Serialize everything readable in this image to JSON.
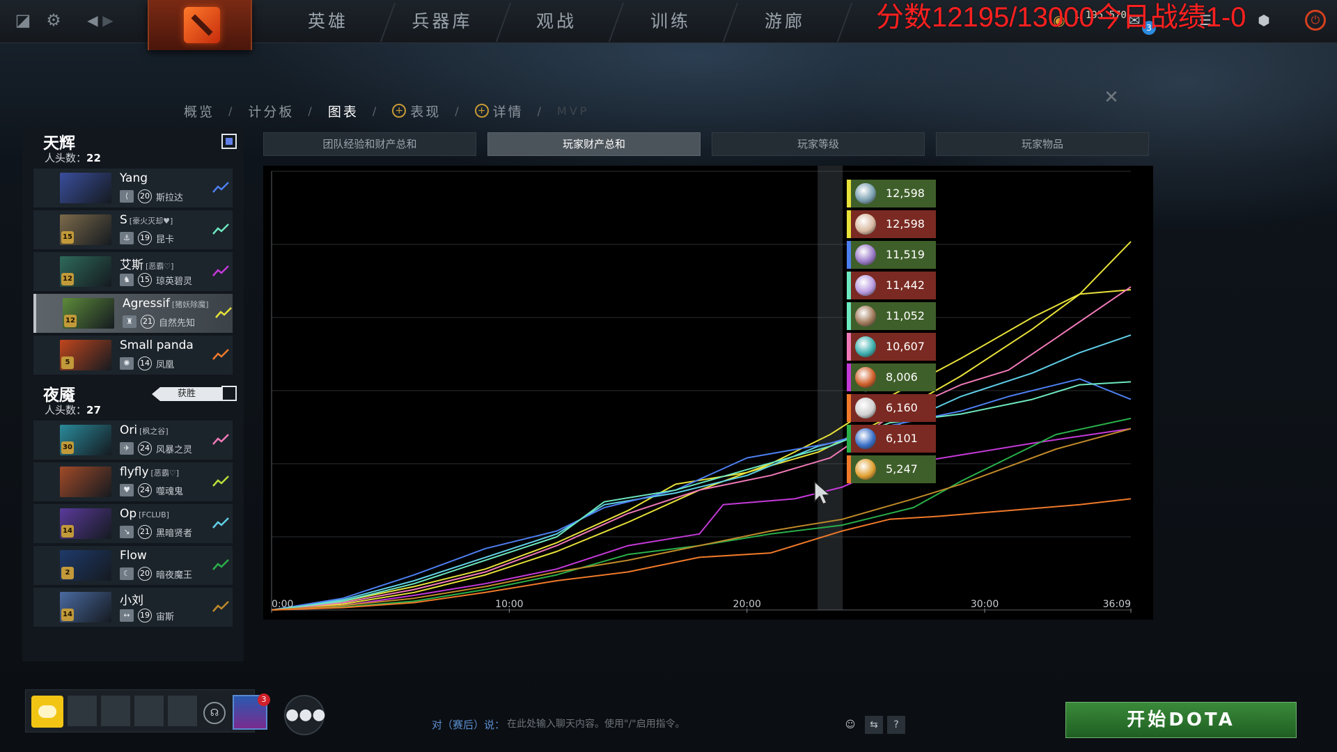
{
  "topbar": {
    "nav": [
      "英雄",
      "兵器库",
      "观战",
      "训练",
      "游廊"
    ],
    "overlay": "分数12195/13000今日战绩1-0",
    "gold": "1 195 570",
    "notifications": "3"
  },
  "breadcrumb": {
    "overview": "概览",
    "scoreboard": "计分板",
    "graphs": "图表",
    "performance": "表现",
    "details": "详情",
    "mvp": "MVP",
    "sep": "/"
  },
  "radiant": {
    "name": "天辉",
    "kills_label": "人头数：",
    "kills": "22",
    "players": [
      {
        "name": "Yang",
        "tag": "",
        "rank": "20",
        "hero": "斯拉达",
        "color": "#4d7ff0",
        "portrait": "#3a4e9c",
        "level": "",
        "role_icon": "⟨"
      },
      {
        "name": "S",
        "tag": "[豪火灭却♥]",
        "rank": "19",
        "hero": "昆卡",
        "color": "#6ee8c0",
        "portrait": "#7c6a4a",
        "level": "15",
        "role_icon": "⚓"
      },
      {
        "name": "艾斯",
        "tag": "[恶霸♡]",
        "rank": "15",
        "hero": "琼英碧灵",
        "color": "#c43ad8",
        "portrait": "#2e6a5a",
        "level": "12",
        "role_icon": "♞"
      },
      {
        "name": "Agressif",
        "tag": "[猪妖除魔]",
        "rank": "21",
        "hero": "自然先知",
        "color": "#e8e23a",
        "portrait": "#5d8a3a",
        "level": "12",
        "role_icon": "♜"
      },
      {
        "name": "Small panda",
        "tag": "",
        "rank": "14",
        "hero": "凤凰",
        "color": "#f07a2a",
        "portrait": "#c0461e",
        "level": "5",
        "role_icon": "✺"
      }
    ]
  },
  "dire": {
    "name": "夜魇",
    "kills_label": "人头数：",
    "kills": "27",
    "win_badge": "获胜",
    "players": [
      {
        "name": "Ori",
        "tag": "[枫之谷]",
        "rank": "24",
        "hero": "风暴之灵",
        "color": "#f07ab8",
        "portrait": "#2a8a9a",
        "level": "30",
        "role_icon": "✈"
      },
      {
        "name": "flyfly",
        "tag": "[恶霸♡]",
        "rank": "24",
        "hero": "噬魂鬼",
        "color": "#b8e23a",
        "portrait": "#a04a28",
        "level": "",
        "role_icon": "♥"
      },
      {
        "name": "Op",
        "tag": "[FCLUB]",
        "rank": "21",
        "hero": "黑暗贤者",
        "color": "#60d0e8",
        "portrait": "#5a3a9a",
        "level": "14",
        "role_icon": "↘"
      },
      {
        "name": "Flow",
        "tag": "",
        "rank": "20",
        "hero": "暗夜魔王",
        "color": "#2ab04a",
        "portrait": "#1e3a6a",
        "level": "2",
        "role_icon": "☾"
      },
      {
        "name": "小刘",
        "tag": "",
        "rank": "19",
        "hero": "宙斯",
        "color": "#c08a2a",
        "portrait": "#4a6aa0",
        "level": "14",
        "role_icon": "↔"
      }
    ]
  },
  "tabs": [
    "团队经验和财产总和",
    "玩家财产总和",
    "玩家等级",
    "玩家物品"
  ],
  "active_tab": 1,
  "chart_data": {
    "type": "line",
    "title": "",
    "xlabel": "",
    "ylabel": "",
    "x_ticks": [
      "0:00",
      "10:00",
      "20:00",
      "30:00",
      "36:09"
    ],
    "x_tick_minutes": [
      0,
      10,
      20,
      30,
      36.15
    ],
    "xlim": [
      0,
      36.15
    ],
    "ylim": [
      0,
      15000
    ],
    "grid": true,
    "hover_minute": 23.5,
    "legend": [
      {
        "value": "12,598",
        "border": "#e8e23a",
        "bg": "#3f5f2a",
        "icon": "#7aa0b0"
      },
      {
        "value": "12,598",
        "border": "#e8e23a",
        "bg": "#7a2a22",
        "icon": "#d8b8a0"
      },
      {
        "value": "11,519",
        "border": "#4d7ff0",
        "bg": "#3f5f2a",
        "icon": "#9a7ac8"
      },
      {
        "value": "11,442",
        "border": "#6ee8c0",
        "bg": "#7a2a22",
        "icon": "#b89ae0"
      },
      {
        "value": "11,052",
        "border": "#6ee8c0",
        "bg": "#3f5f2a",
        "icon": "#a07a5a"
      },
      {
        "value": "10,607",
        "border": "#f07ab8",
        "bg": "#7a2a22",
        "icon": "#40b0b0"
      },
      {
        "value": "8,006",
        "border": "#c43ad8",
        "bg": "#3f5f2a",
        "icon": "#d0602a"
      },
      {
        "value": "6,160",
        "border": "#f07a2a",
        "bg": "#7a2a22",
        "icon": "#d0d0d0"
      },
      {
        "value": "6,101",
        "border": "#2ab04a",
        "bg": "#7a2a22",
        "icon": "#3a70c8"
      },
      {
        "value": "5,247",
        "border": "#f07a2a",
        "bg": "#3f5f2a",
        "icon": "#e0a030"
      }
    ],
    "series": [
      {
        "color": "#e8e23a",
        "points": [
          [
            0,
            0
          ],
          [
            3,
            200
          ],
          [
            6,
            600
          ],
          [
            9,
            1200
          ],
          [
            12,
            2000
          ],
          [
            15,
            3000
          ],
          [
            18,
            4100
          ],
          [
            21,
            5000
          ],
          [
            23.5,
            6000
          ],
          [
            26,
            7300
          ],
          [
            29,
            8600
          ],
          [
            32,
            10000
          ],
          [
            34,
            10800
          ],
          [
            36.15,
            12598
          ]
        ]
      },
      {
        "color": "#e8e23a",
        "points": [
          [
            0,
            0
          ],
          [
            3,
            300
          ],
          [
            6,
            800
          ],
          [
            9,
            1400
          ],
          [
            12,
            2300
          ],
          [
            15,
            3400
          ],
          [
            17,
            4300
          ],
          [
            20,
            4700
          ],
          [
            23,
            5400
          ],
          [
            26,
            6600
          ],
          [
            29,
            8000
          ],
          [
            32,
            9600
          ],
          [
            34,
            10800
          ],
          [
            36.15,
            10950
          ]
        ]
      },
      {
        "color": "#f07ab8",
        "points": [
          [
            0,
            0
          ],
          [
            3,
            250
          ],
          [
            6,
            700
          ],
          [
            9,
            1300
          ],
          [
            12,
            2200
          ],
          [
            15,
            3300
          ],
          [
            18,
            4100
          ],
          [
            21,
            4600
          ],
          [
            23.5,
            5200
          ],
          [
            26,
            6600
          ],
          [
            29,
            7700
          ],
          [
            31,
            8200
          ],
          [
            33,
            9300
          ],
          [
            36.15,
            11050
          ]
        ]
      },
      {
        "color": "#60d0e8",
        "points": [
          [
            0,
            0
          ],
          [
            3,
            350
          ],
          [
            6,
            1000
          ],
          [
            9,
            1800
          ],
          [
            12,
            2600
          ],
          [
            14,
            3600
          ],
          [
            17,
            4000
          ],
          [
            20,
            4600
          ],
          [
            23,
            5600
          ],
          [
            26,
            6200
          ],
          [
            29,
            7300
          ],
          [
            32,
            8100
          ],
          [
            34,
            8800
          ],
          [
            36.15,
            9400
          ]
        ]
      },
      {
        "color": "#4d7ff0",
        "points": [
          [
            0,
            0
          ],
          [
            3,
            400
          ],
          [
            6,
            1200
          ],
          [
            9,
            2100
          ],
          [
            12,
            2700
          ],
          [
            14,
            3500
          ],
          [
            17,
            4100
          ],
          [
            20,
            5200
          ],
          [
            23.5,
            5700
          ],
          [
            26,
            6300
          ],
          [
            29,
            6800
          ],
          [
            31,
            7300
          ],
          [
            34,
            7900
          ],
          [
            36.15,
            7200
          ]
        ]
      },
      {
        "color": "#6ee8c0",
        "points": [
          [
            0,
            0
          ],
          [
            3,
            300
          ],
          [
            6,
            900
          ],
          [
            9,
            1700
          ],
          [
            12,
            2500
          ],
          [
            14,
            3700
          ],
          [
            17,
            4100
          ],
          [
            20,
            4800
          ],
          [
            23.5,
            5600
          ],
          [
            26,
            6400
          ],
          [
            29,
            6700
          ],
          [
            32,
            7200
          ],
          [
            34,
            7700
          ],
          [
            36.15,
            7800
          ]
        ]
      },
      {
        "color": "#c43ad8",
        "points": [
          [
            0,
            0
          ],
          [
            3,
            150
          ],
          [
            6,
            500
          ],
          [
            9,
            900
          ],
          [
            12,
            1400
          ],
          [
            15,
            2200
          ],
          [
            18,
            2600
          ],
          [
            19,
            3600
          ],
          [
            22,
            3800
          ],
          [
            24,
            4200
          ],
          [
            26,
            4900
          ],
          [
            29,
            5300
          ],
          [
            32,
            5700
          ],
          [
            36.15,
            6200
          ]
        ]
      },
      {
        "color": "#2ab04a",
        "points": [
          [
            0,
            0
          ],
          [
            3,
            100
          ],
          [
            6,
            300
          ],
          [
            9,
            700
          ],
          [
            12,
            1200
          ],
          [
            15,
            1900
          ],
          [
            18,
            2200
          ],
          [
            21,
            2600
          ],
          [
            24,
            2900
          ],
          [
            27,
            3500
          ],
          [
            29,
            4400
          ],
          [
            31,
            5200
          ],
          [
            33,
            6000
          ],
          [
            36.15,
            6550
          ]
        ]
      },
      {
        "color": "#c08a2a",
        "points": [
          [
            0,
            0
          ],
          [
            3,
            150
          ],
          [
            6,
            400
          ],
          [
            9,
            800
          ],
          [
            12,
            1300
          ],
          [
            15,
            1700
          ],
          [
            18,
            2200
          ],
          [
            21,
            2700
          ],
          [
            24,
            3100
          ],
          [
            27,
            3800
          ],
          [
            29,
            4300
          ],
          [
            31,
            4900
          ],
          [
            33,
            5500
          ],
          [
            36.15,
            6200
          ]
        ]
      },
      {
        "color": "#f07a2a",
        "points": [
          [
            0,
            0
          ],
          [
            3,
            80
          ],
          [
            6,
            250
          ],
          [
            9,
            600
          ],
          [
            12,
            1000
          ],
          [
            15,
            1300
          ],
          [
            18,
            1800
          ],
          [
            21,
            1950
          ],
          [
            24,
            2700
          ],
          [
            26,
            3100
          ],
          [
            28,
            3200
          ],
          [
            31,
            3400
          ],
          [
            34,
            3600
          ],
          [
            36.15,
            3800
          ]
        ]
      }
    ]
  },
  "bottom": {
    "chat_label": "对（赛后）说：",
    "chat_placeholder": "在此处输入聊天内容。使用\"/\"启用指令。",
    "friend_badge": "3",
    "play_button": "开始DOTA"
  }
}
